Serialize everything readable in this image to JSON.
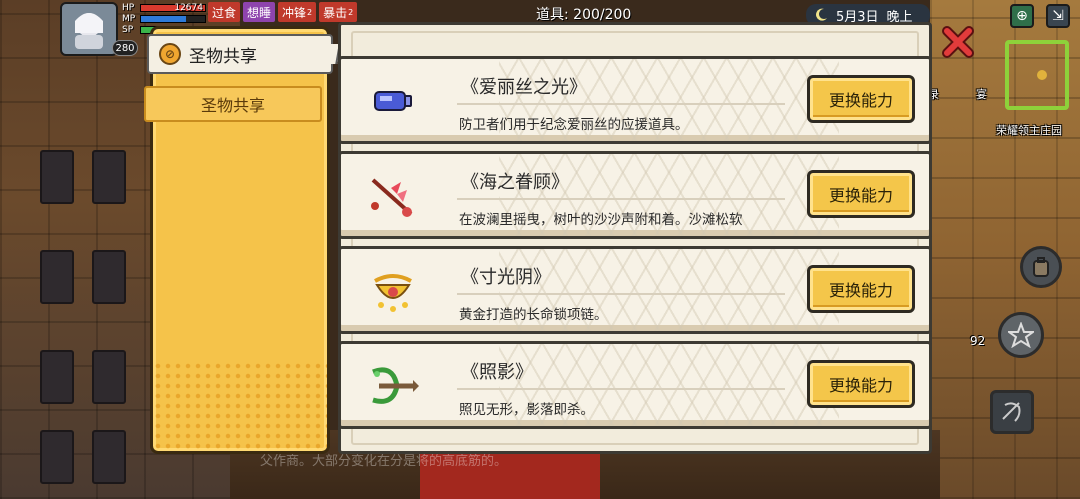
{
  "hud": {
    "hp_label": "HP",
    "hp_value": "12674",
    "hp_fill": 1.0,
    "mp_label": "MP",
    "mp_fill": 0.7,
    "sp_label": "SP",
    "sp_fill": 0.25,
    "level": "280",
    "status_tags": [
      {
        "label": "过食",
        "sup": "",
        "color": "#c0392b"
      },
      {
        "label": "想睡",
        "sup": "",
        "color": "#8e44ad"
      },
      {
        "label": "冲锋",
        "sup": "2",
        "color": "#c0392b"
      },
      {
        "label": "暴击",
        "sup": "2",
        "color": "#c0392b"
      }
    ],
    "capacity_label": "道具: 200/200",
    "date": "5月3日",
    "time_of_day": "晚上"
  },
  "background": {
    "ticker_text": "父作商。大部分变化在分是将的高底筋的。",
    "label_manor": "荣耀领主庄园",
    "label_record": "录",
    "label_banquet": "宴",
    "count_92": "92"
  },
  "sidebar": {
    "header_label": "圣物共享",
    "tab_label": "圣物共享"
  },
  "relics": [
    {
      "name": "《爱丽丝之光》",
      "desc": "防卫者们用于纪念爱丽丝的应援道具。",
      "button": "更换能力",
      "icon": "battery-icon"
    },
    {
      "name": "《海之眷顾》",
      "desc": "在波澜里摇曳，树叶的沙沙声附和着。沙滩松软",
      "button": "更换能力",
      "icon": "spear-icon"
    },
    {
      "name": "《寸光阴》",
      "desc": "黄金打造的长命锁项链。",
      "button": "更换能力",
      "icon": "gold-lock-icon"
    },
    {
      "name": "《照影》",
      "desc": "照见无形，影落即杀。",
      "button": "更换能力",
      "icon": "crossbow-icon"
    }
  ],
  "colors": {
    "accent_yellow": "#f4c64a",
    "panel_cream": "#f7f2e6",
    "close_red": "#e23b3b"
  }
}
